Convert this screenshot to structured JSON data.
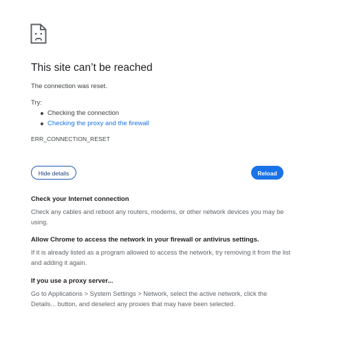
{
  "icon": {
    "name": "sad-page-icon"
  },
  "error": {
    "title": "This site can’t be reached",
    "subtitle": "The connection was reset.",
    "try_label": "Try:",
    "suggestions": [
      {
        "label": "Checking the connection",
        "is_link": false
      },
      {
        "label": "Checking the proxy and the firewall",
        "is_link": true
      }
    ],
    "code": "ERR_CONNECTION_RESET"
  },
  "buttons": {
    "details_label": "Hide details",
    "reload_label": "Reload"
  },
  "details": [
    {
      "heading": "Check your Internet connection",
      "body": "Check any cables and reboot any routers, modems, or other network devices you may be using."
    },
    {
      "heading": "Allow Chrome to access the network in your firewall or antivirus settings.",
      "body": "If it is already listed as a program allowed to access the network, try removing it from the list and adding it again."
    },
    {
      "heading": "If you use a proxy server...",
      "body": "Go to Applications > System Settings > Network, select the active network, click the Details... button, and deselect any proxies that may have been selected."
    }
  ],
  "colors": {
    "accent": "#1a73e8",
    "text": "#202124",
    "secondary_text": "#5f6368"
  }
}
